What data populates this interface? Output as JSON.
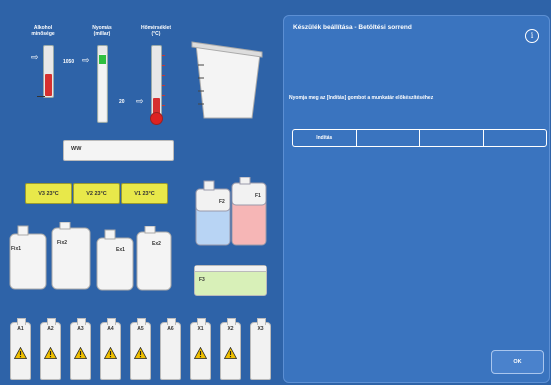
{
  "gauges": {
    "alcohol": {
      "label_line1": "Alkohol",
      "label_line2": "minősége",
      "level_pct": 43
    },
    "pressure": {
      "label_line1": "Nyomás",
      "label_line2": "(millar)",
      "value": "1050",
      "level_pct": 88
    },
    "temperature": {
      "label_line1": "Hőmérséklet",
      "label_line2": "(°C)",
      "value": "20",
      "level_pct": 25
    }
  },
  "ww_tank": {
    "label": "WW"
  },
  "wax_baths": [
    {
      "label": "V3  23°C"
    },
    {
      "label": "V2  23°C"
    },
    {
      "label": "V1  23°C"
    }
  ],
  "jugs": {
    "f2": "F2",
    "f1": "F1",
    "fix1": "Fix1",
    "fix2": "Fix2",
    "ex1": "Ex1",
    "ex2": "Ex2",
    "f3": "F3"
  },
  "bottles": [
    {
      "label": "A1",
      "warning": true
    },
    {
      "label": "A2",
      "warning": true
    },
    {
      "label": "A3",
      "warning": true
    },
    {
      "label": "A4",
      "warning": true
    },
    {
      "label": "A5",
      "warning": true
    },
    {
      "label": "A6",
      "warning": false
    },
    {
      "label": "X1",
      "warning": true
    },
    {
      "label": "X2",
      "warning": true
    },
    {
      "label": "X3",
      "warning": false
    }
  ],
  "panel": {
    "title": "Készülék beállítása - Betöltési sorrend",
    "info_icon": "i",
    "instruction": "Nyomja meg az [Indítás] gombot a munkatár előkészítéséhez",
    "sequence": [
      {
        "label": "Indítás"
      },
      {
        "label": ""
      },
      {
        "label": ""
      },
      {
        "label": ""
      }
    ],
    "ok_label": "OK"
  },
  "colors": {
    "background": "#2e63a8",
    "panel": "#3a74bf",
    "wax": "#e8e84a",
    "warning": "#f0c000"
  }
}
